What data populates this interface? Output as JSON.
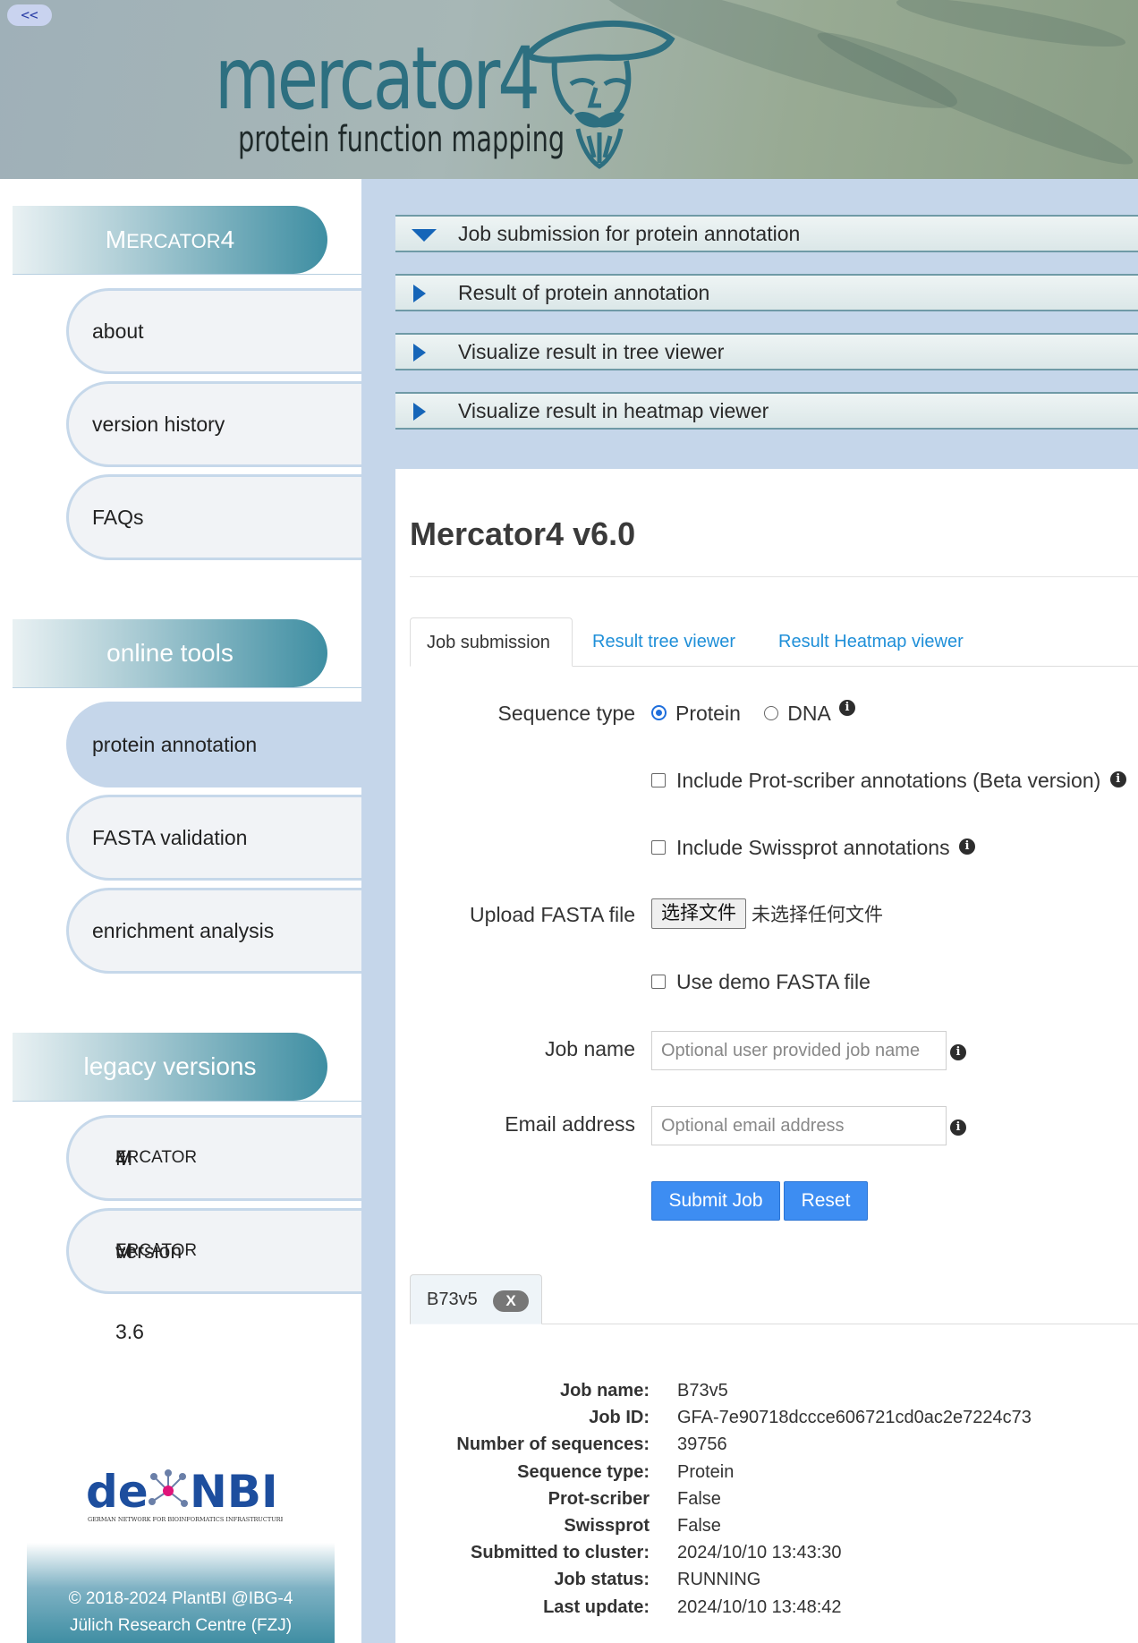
{
  "header": {
    "collapse_label": "<<",
    "logo_title": "mercator4",
    "logo_subtitle": "protein function mapping"
  },
  "sidebar": {
    "section_mercator": {
      "prefix": "M",
      "rest": "ERCATOR",
      "suffix": "4"
    },
    "items_top": [
      "about",
      "version history",
      "FAQs"
    ],
    "section_tools": "online tools",
    "items_tools": [
      "protein annotation",
      "FASTA validation",
      "enrichment analysis"
    ],
    "section_legacy": "legacy versions",
    "legacy_item1": {
      "prefix": "M",
      "rest": "ERCATOR",
      "suffix": "4"
    },
    "legacy_item2": {
      "prefix": "M",
      "rest": "ERCATOR",
      "suffix": " version 3.6"
    },
    "denbi_logo": "de.NBI",
    "denbi_caption": "GERMAN NETWORK FOR BIOINFORMATICS INFRASTRUCTURE",
    "footer_line1": "© 2018-2024 PlantBI @IBG-4",
    "footer_line2": "Jülich Research Centre (FZJ)"
  },
  "accordion": [
    "Job submission for protein annotation",
    "Result of protein annotation",
    "Visualize result in tree viewer",
    "Visualize result in heatmap viewer"
  ],
  "main": {
    "title": "Mercator4 v6.0",
    "tabs": [
      "Job submission",
      "Result tree viewer",
      "Result Heatmap viewer"
    ],
    "form": {
      "sequence_type_label": "Sequence type",
      "opt_protein": "Protein",
      "opt_dna": "DNA",
      "prot_scriber_label": "Include Prot-scriber annotations (Beta version)",
      "swissprot_label": "Include Swissprot annotations",
      "upload_label": "Upload FASTA file",
      "file_button": "选择文件",
      "file_status": "未选择任何文件",
      "demo_label": "Use demo FASTA file",
      "job_name_label": "Job name",
      "job_name_placeholder": "Optional user provided job name",
      "email_label": "Email address",
      "email_placeholder": "Optional email address",
      "submit": "Submit Job",
      "reset": "Reset"
    },
    "job_tab": {
      "name": "B73v5",
      "close": "X"
    },
    "job_details": [
      {
        "k": "Job name:",
        "v": "B73v5"
      },
      {
        "k": "Job ID:",
        "v": "GFA-7e90718dccce606721cd0ac2e7224c73"
      },
      {
        "k": "Number of sequences:",
        "v": "39756"
      },
      {
        "k": "Sequence type:",
        "v": "Protein"
      },
      {
        "k": "Prot-scriber",
        "v": "False"
      },
      {
        "k": "Swissprot",
        "v": "False"
      },
      {
        "k": "Submitted to cluster:",
        "v": "2024/10/10 13:43:30"
      },
      {
        "k": "Job status:",
        "v": "RUNNING"
      },
      {
        "k": "Last update:",
        "v": "2024/10/10 13:48:42"
      }
    ]
  }
}
